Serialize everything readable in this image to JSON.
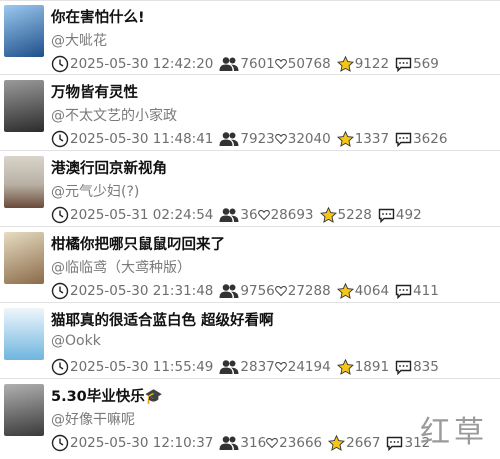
{
  "posts": [
    {
      "title": "你在害怕什么!",
      "author": "@大呲花",
      "date": "2025-05-30 12:42:20",
      "views": "7601",
      "likes": "50768",
      "favorites": "9122",
      "comments": "569",
      "thumb_colors": [
        "#6aa8e0",
        "#1e4f8a"
      ]
    },
    {
      "title": "万物皆有灵性",
      "author": "@不太文艺的小家政",
      "date": "2025-05-30 11:48:41",
      "views": "7923",
      "likes": "32040",
      "favorites": "1337",
      "comments": "3626",
      "thumb_colors": [
        "#6f6f6f",
        "#2c2c2c"
      ]
    },
    {
      "title": "港澳行回京新视角",
      "author": "@元气少妇(?)",
      "date": "2025-05-31 02:24:54",
      "views": "36",
      "likes": "28693",
      "favorites": "5228",
      "comments": "492",
      "thumb_colors": [
        "#c9c3b8",
        "#6b4a3a"
      ]
    },
    {
      "title": "柑橘你把哪只鼠鼠叼回来了",
      "author": "@临临鸢（大鸢种版）",
      "date": "2025-05-30 21:31:48",
      "views": "9756",
      "likes": "27288",
      "favorites": "4064",
      "comments": "411",
      "thumb_colors": [
        "#d8c9a8",
        "#8a6b48"
      ]
    },
    {
      "title": "猫耶真的很适合蓝白色 超级好看啊",
      "author": "@Ookk",
      "date": "2025-05-30 11:55:49",
      "views": "2837",
      "likes": "24194",
      "favorites": "1891",
      "comments": "835",
      "thumb_colors": [
        "#cfe6f4",
        "#6fb5df"
      ]
    },
    {
      "title": "5.30毕业快乐🎓",
      "author": "@好像干嘛呢",
      "date": "2025-05-30 12:10:37",
      "views": "316",
      "likes": "23666",
      "favorites": "2667",
      "comments": "312",
      "thumb_colors": [
        "#8a8a8a",
        "#3a3a3a"
      ]
    }
  ],
  "watermark": "红草",
  "colors": {
    "star": "#f5c518",
    "icon": "#333333",
    "text_meta": "#6e6e6e"
  },
  "icons": [
    "clock-icon",
    "users-icon",
    "heart-icon",
    "star-icon",
    "comment-icon"
  ]
}
